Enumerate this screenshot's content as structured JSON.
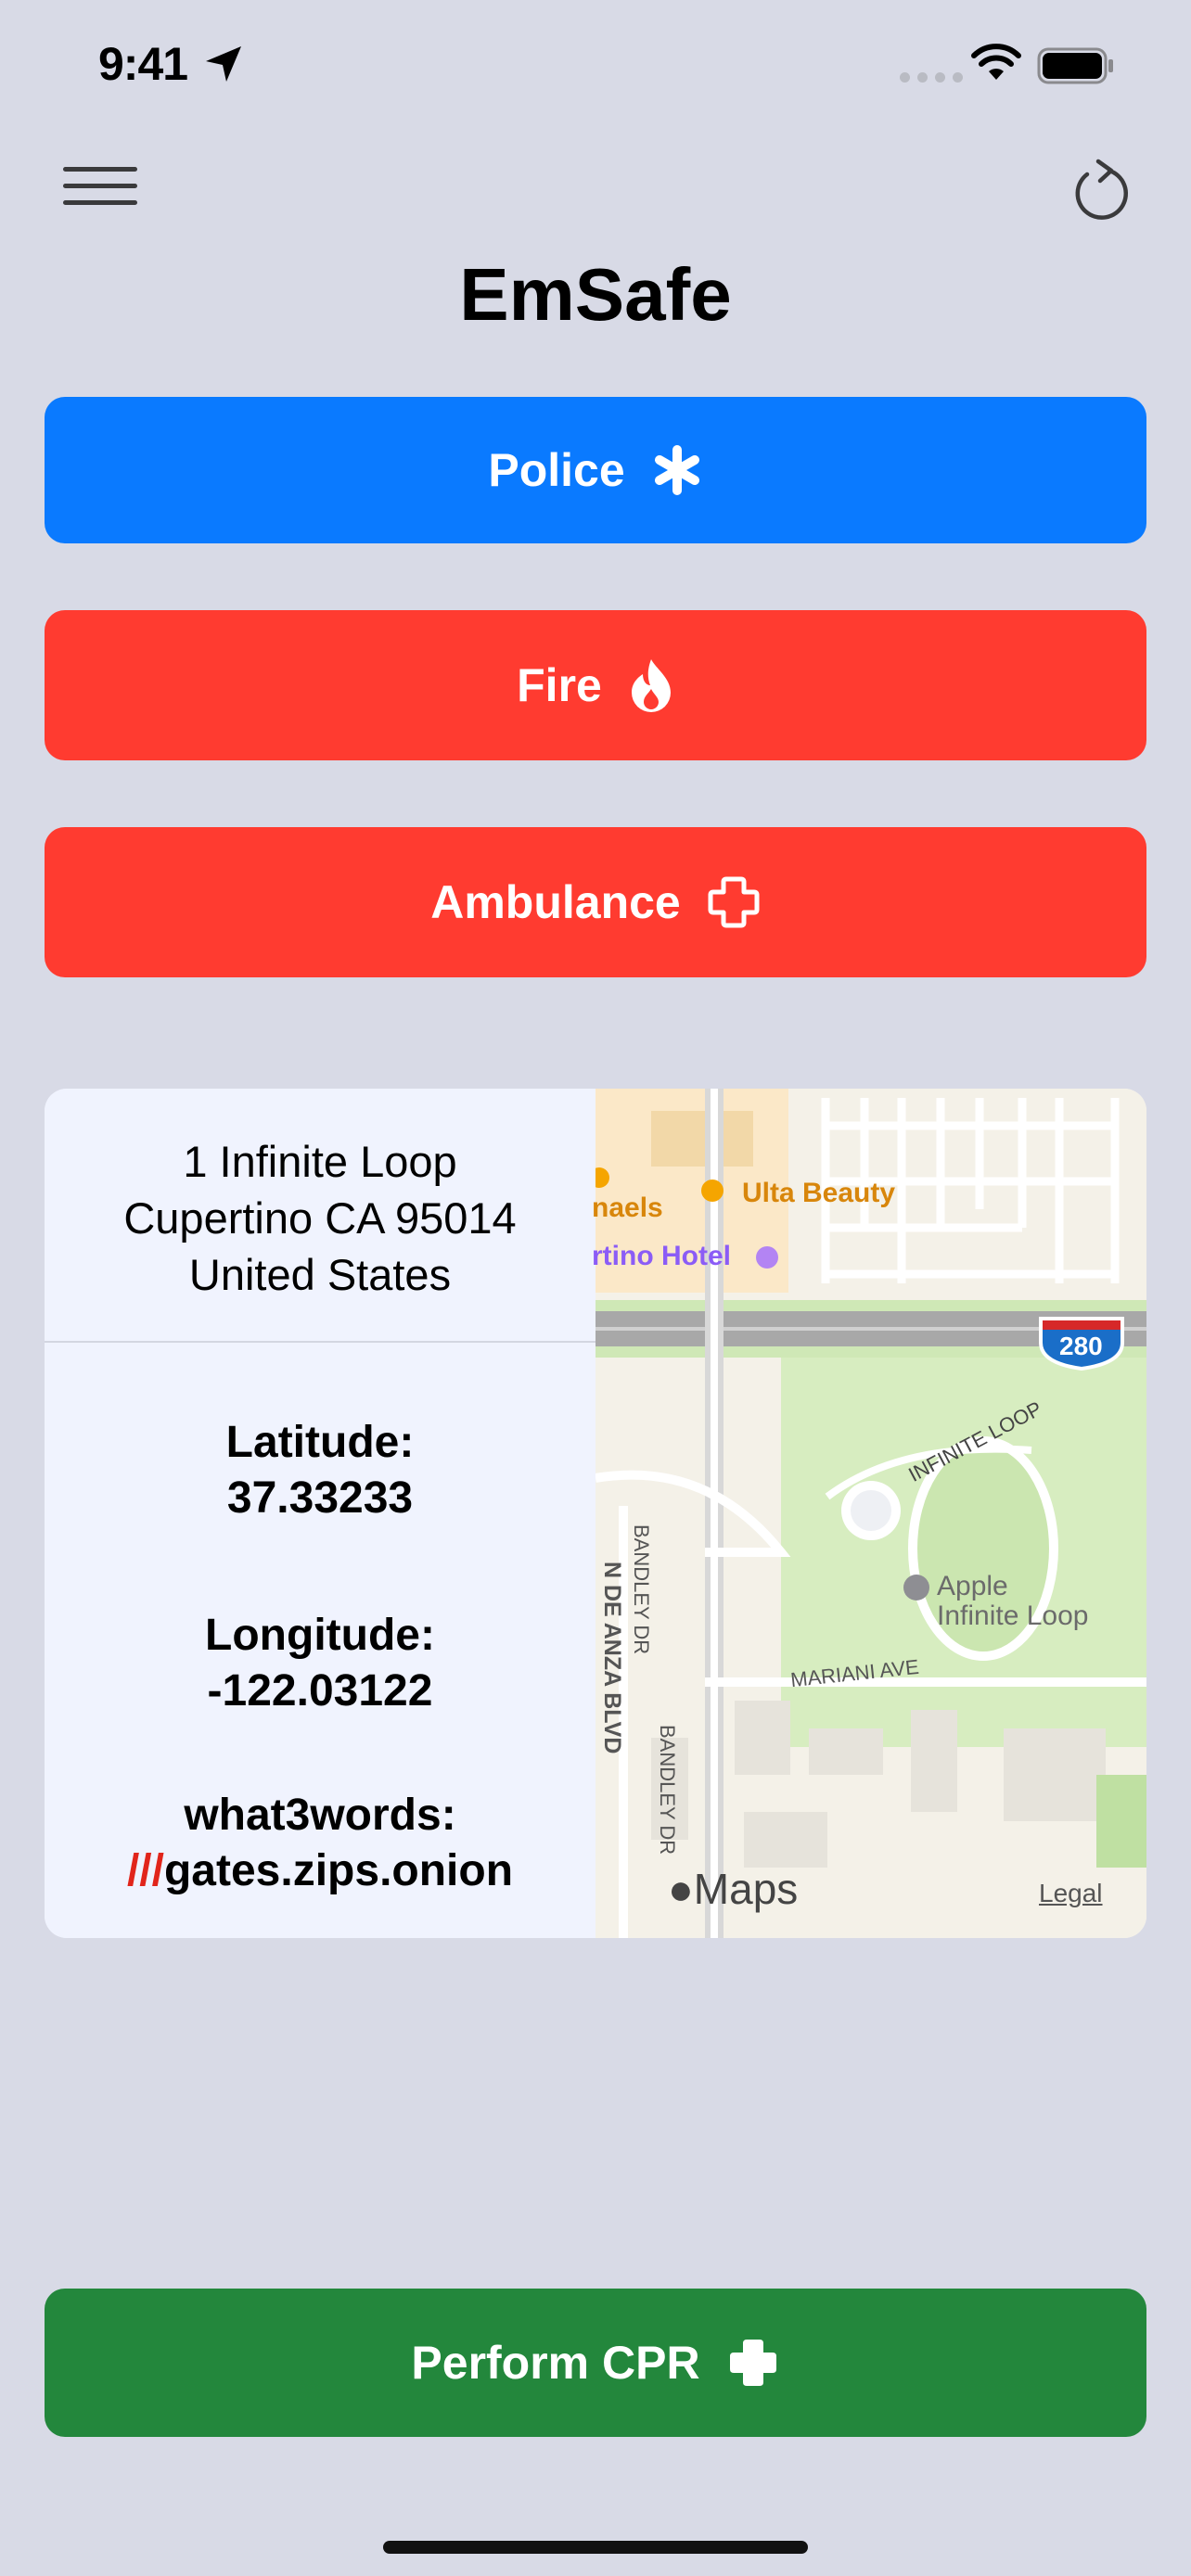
{
  "status_bar": {
    "time": "9:41"
  },
  "app": {
    "title": "EmSafe"
  },
  "buttons": {
    "police": {
      "label": "Police",
      "color": "#0a7aff"
    },
    "fire": {
      "label": "Fire",
      "color": "#ff3b30"
    },
    "ambulance": {
      "label": "Ambulance",
      "color": "#ff3b30"
    },
    "cpr": {
      "label": "Perform CPR",
      "color": "#23873c"
    }
  },
  "location": {
    "address_line1": "1 Infinite Loop",
    "address_line2": "Cupertino CA 95014",
    "address_line3": "United States",
    "latitude_label": "Latitude:",
    "latitude": "37.33233",
    "longitude_label": "Longitude:",
    "longitude": "-122.03122",
    "w3w_label": "what3words:",
    "w3w_prefix": "///",
    "w3w_value": "gates.zips.onion"
  },
  "map": {
    "labels": {
      "ulta": "Ulta Beauty",
      "hotel": "rtino Hotel",
      "naels": "naels",
      "highway": "280",
      "de_anza": "N DE ANZA BLVD",
      "infinite_loop_road": "INFINITE LOOP",
      "apple_poi_1": "Apple",
      "apple_poi_2": "Infinite Loop",
      "mariani": "MARIANI AVE",
      "bandley_1": "BANDLEY DR",
      "bandley_2": "BANDLEY DR"
    },
    "attribution": "Maps",
    "legal": "Legal"
  },
  "icons": {
    "menu": "hamburger-icon",
    "refresh": "refresh-icon",
    "police": "asterisk-icon",
    "fire": "flame-icon",
    "ambulance": "cross-outline-icon",
    "cpr": "cross-filled-icon"
  }
}
